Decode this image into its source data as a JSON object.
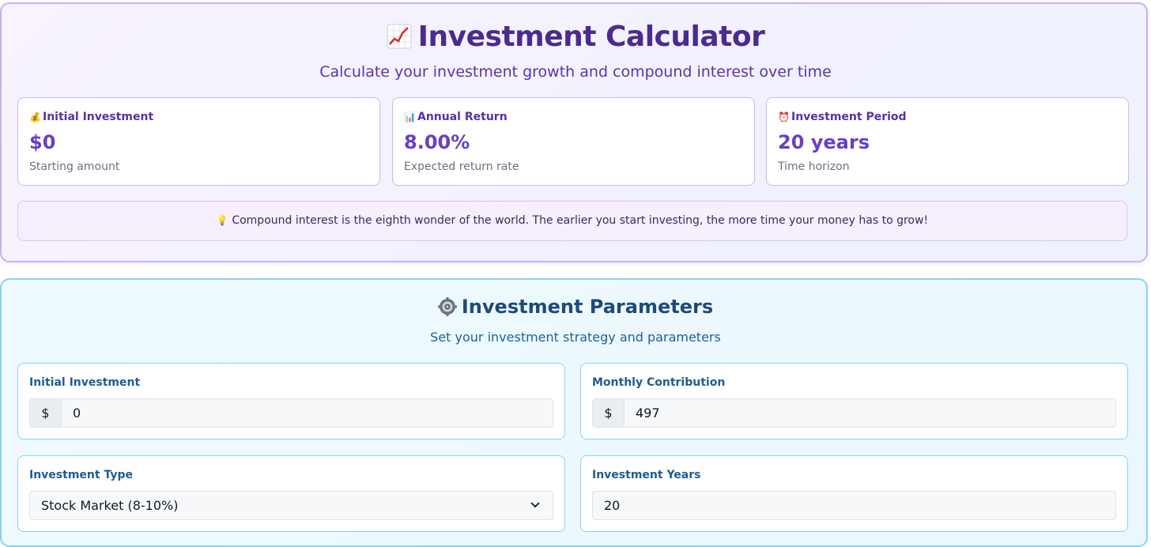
{
  "header": {
    "title": "Investment Calculator",
    "title_icon": "chart-increasing-icon",
    "subtitle": "Calculate your investment growth and compound interest over time"
  },
  "stats": [
    {
      "icon": "money-bag-icon",
      "label": "Initial Investment",
      "value": "$0",
      "sub": "Starting amount"
    },
    {
      "icon": "bar-chart-icon",
      "label": "Annual Return",
      "value": "8.00%",
      "sub": "Expected return rate"
    },
    {
      "icon": "alarm-clock-icon",
      "label": "Investment Period",
      "value": "20 years",
      "sub": "Time horizon"
    }
  ],
  "tip": {
    "icon": "lightbulb-icon",
    "text": "Compound interest is the eighth wonder of the world. The earlier you start investing, the more time your money has to grow!"
  },
  "params": {
    "title": "Investment Parameters",
    "title_icon": "gear-icon",
    "subtitle": "Set your investment strategy and parameters",
    "initial": {
      "label": "Initial Investment",
      "prefix": "$",
      "value": "0"
    },
    "monthly": {
      "label": "Monthly Contribution",
      "prefix": "$",
      "value": "497"
    },
    "type": {
      "label": "Investment Type",
      "selected": "Stock Market (8-10%)"
    },
    "years": {
      "label": "Investment Years",
      "value": "20"
    }
  },
  "colors": {
    "header_accent": "#4c2a8f",
    "stat_value": "#6a3fc0",
    "params_accent": "#1e4a78",
    "field_label": "#1e5c94"
  }
}
